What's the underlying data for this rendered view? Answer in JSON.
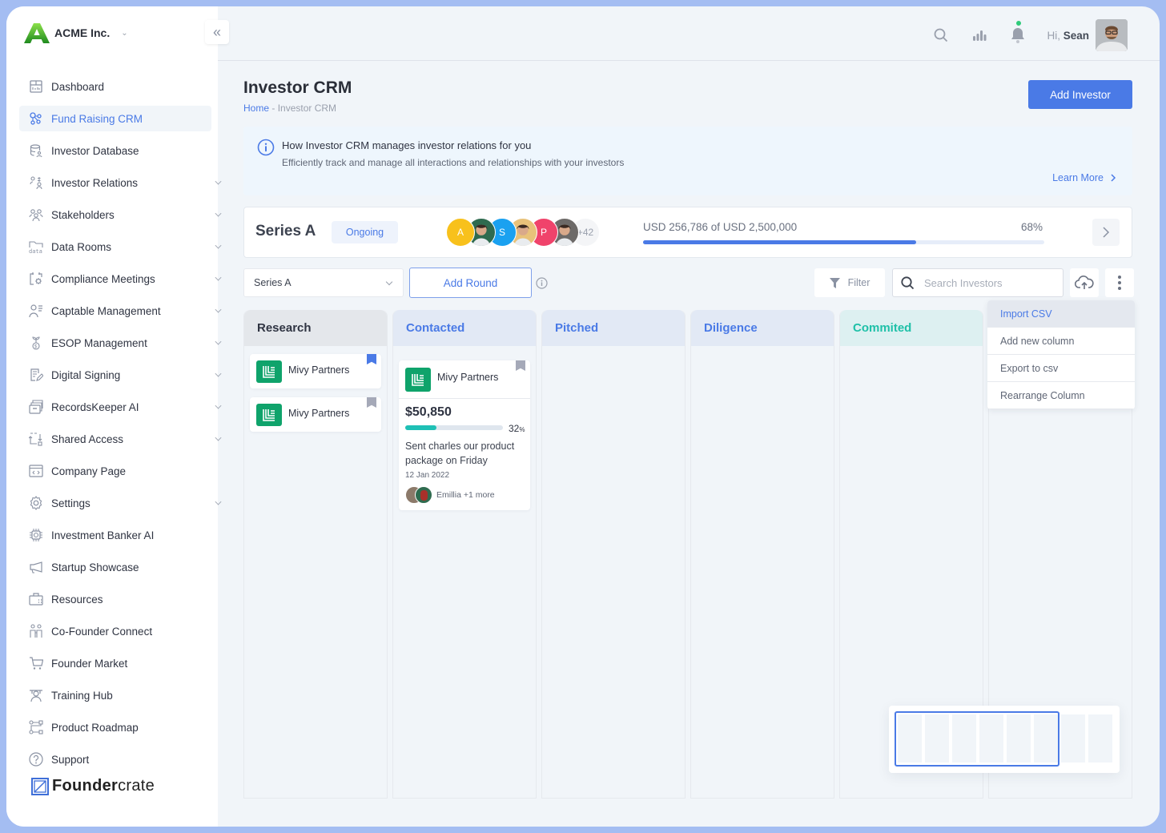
{
  "brand": {
    "name": "ACME Inc."
  },
  "sidebar": {
    "items": [
      {
        "label": "Dashboard",
        "icon": "dashboard-icon",
        "expandable": false,
        "active": false
      },
      {
        "label": "Fund Raising CRM",
        "icon": "fund-raising-icon",
        "expandable": false,
        "active": true
      },
      {
        "label": "Investor Database",
        "icon": "database-icon",
        "expandable": false,
        "active": false
      },
      {
        "label": "Investor Relations",
        "icon": "investor-relations-icon",
        "expandable": true,
        "active": false
      },
      {
        "label": "Stakeholders",
        "icon": "stakeholders-icon",
        "expandable": true,
        "active": false
      },
      {
        "label": "Data Rooms",
        "icon": "data-rooms-icon",
        "expandable": true,
        "active": false
      },
      {
        "label": "Compliance Meetings",
        "icon": "calendar-gear-icon",
        "expandable": true,
        "active": false
      },
      {
        "label": "Captable Management",
        "icon": "captable-icon",
        "expandable": true,
        "active": false
      },
      {
        "label": "ESOP Management",
        "icon": "esop-icon",
        "expandable": true,
        "active": false
      },
      {
        "label": "Digital Signing",
        "icon": "signing-icon",
        "expandable": true,
        "active": false
      },
      {
        "label": "RecordsKeeper AI",
        "icon": "records-icon",
        "expandable": true,
        "active": false
      },
      {
        "label": "Shared Access",
        "icon": "shared-access-icon",
        "expandable": true,
        "active": false
      },
      {
        "label": "Company Page",
        "icon": "company-page-icon",
        "expandable": false,
        "active": false
      },
      {
        "label": "Settings",
        "icon": "gear-icon",
        "expandable": true,
        "active": false
      },
      {
        "label": "Investment Banker AI",
        "icon": "chip-icon",
        "expandable": false,
        "active": false
      },
      {
        "label": "Startup Showcase",
        "icon": "megaphone-icon",
        "expandable": false,
        "active": false
      },
      {
        "label": "Resources",
        "icon": "briefcase-icon",
        "expandable": false,
        "active": false
      },
      {
        "label": "Co-Founder Connect",
        "icon": "cofounder-icon",
        "expandable": false,
        "active": false
      },
      {
        "label": "Founder Market",
        "icon": "cart-icon",
        "expandable": false,
        "active": false
      },
      {
        "label": "Training Hub",
        "icon": "training-icon",
        "expandable": false,
        "active": false
      },
      {
        "label": "Product Roadmap",
        "icon": "roadmap-icon",
        "expandable": false,
        "active": false
      },
      {
        "label": "Support",
        "icon": "help-icon",
        "expandable": false,
        "active": false
      }
    ],
    "footer_logo": {
      "bold": "Founder",
      "light": "crate"
    }
  },
  "topbar": {
    "greeting": "Hi,",
    "user_name": "Sean"
  },
  "page": {
    "title": "Investor CRM",
    "breadcrumb_home": "Home",
    "breadcrumb_sep": " - ",
    "breadcrumb_current": "Investor CRM",
    "add_investor_label": "Add Investor"
  },
  "info": {
    "title": "How Investor CRM manages investor relations for you",
    "description": "Efficiently track and manage all interactions and relationships with your investors",
    "learn_more": "Learn More"
  },
  "round": {
    "name": "Series A",
    "status": "Ongoing",
    "investors": [
      {
        "initial": "A",
        "color": "#f8c11c"
      },
      {
        "initial": "",
        "color": "#2f6b4f"
      },
      {
        "initial": "S",
        "color": "#1aa1f0"
      },
      {
        "initial": "",
        "color": "#e8c27a"
      },
      {
        "initial": "P",
        "color": "#f0436b"
      },
      {
        "initial": "",
        "color": "#6d6a68"
      }
    ],
    "more_count": "+42",
    "raised_text": "USD 256,786 of USD 2,500,000",
    "progress_percent": 68,
    "progress_label": "68%"
  },
  "toolbar": {
    "round_select": "Series A",
    "add_round_label": "Add Round",
    "filter_label": "Filter",
    "search_placeholder": "Search Investors",
    "search_value": ""
  },
  "board": {
    "columns": [
      {
        "title": "Research",
        "color": "#2f3442",
        "bg": "#e4e7eb"
      },
      {
        "title": "Contacted",
        "color": "#4a7ae6",
        "bg": "#e2e9f5"
      },
      {
        "title": "Pitched",
        "color": "#4a7ae6",
        "bg": "#e2e9f5"
      },
      {
        "title": "Diligence",
        "color": "#4a7ae6",
        "bg": "#e2e9f5"
      },
      {
        "title": "Commited",
        "color": "#1fc0a8",
        "bg": "#ddf0f1"
      }
    ],
    "research_cards": [
      {
        "name": "Mivy Partners",
        "bookmarked": true
      },
      {
        "name": "Mivy Partners",
        "bookmarked": false
      }
    ],
    "contacted_card": {
      "name": "Mivy Partners",
      "amount": "$50,850",
      "progress_percent": 32,
      "progress_label": "32",
      "progress_unit": "%",
      "note": "Sent charles our product package on Friday",
      "date": "12 Jan 2022",
      "people": "Emillia +1 more"
    }
  },
  "more_menu": {
    "items": [
      "Import CSV",
      "Add new column",
      "Export to csv",
      "Rearrange Column"
    ],
    "highlighted": 0
  },
  "colors": {
    "accent": "#4a7ae6",
    "teal": "#1fc0a8",
    "brand_green": "#0fa36b"
  }
}
